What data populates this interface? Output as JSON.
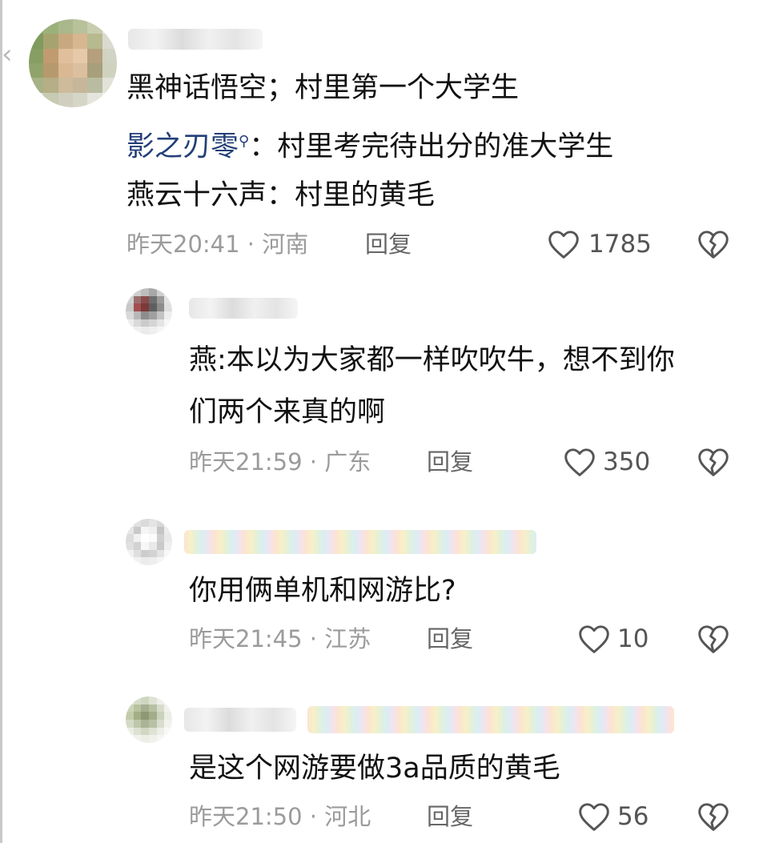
{
  "comments": [
    {
      "lines": [
        "黑神话悟空；村里第一个大学生",
        "：村里考完待出分的准大学生",
        "燕云十六声：村里的黄毛"
      ],
      "mention": "影之刃零",
      "time_loc": "昨天20:41 · 河南",
      "reply_label": "回复",
      "likes": "1785"
    },
    {
      "lines": [
        "燕:本以为大家都一样吹吹牛，想不到你",
        "们两个来真的啊"
      ],
      "time_loc": "昨天21:59 · 广东",
      "reply_label": "回复",
      "likes": "350"
    },
    {
      "lines": [
        "你用俩单机和网游比?"
      ],
      "time_loc": "昨天21:45 · 江苏",
      "reply_label": "回复",
      "likes": "10"
    },
    {
      "lines": [
        "是这个网游要做3a品质的黄毛"
      ],
      "time_loc": "昨天21:50 · 河北",
      "reply_label": "回复",
      "likes": "56"
    }
  ],
  "icons": {
    "like": "heart-outline-icon",
    "dislike": "broken-heart-icon",
    "back": "chevron-left-icon"
  },
  "colors": {
    "mention": "#233f78",
    "meta": "#9b9b9b",
    "text": "#111111"
  }
}
